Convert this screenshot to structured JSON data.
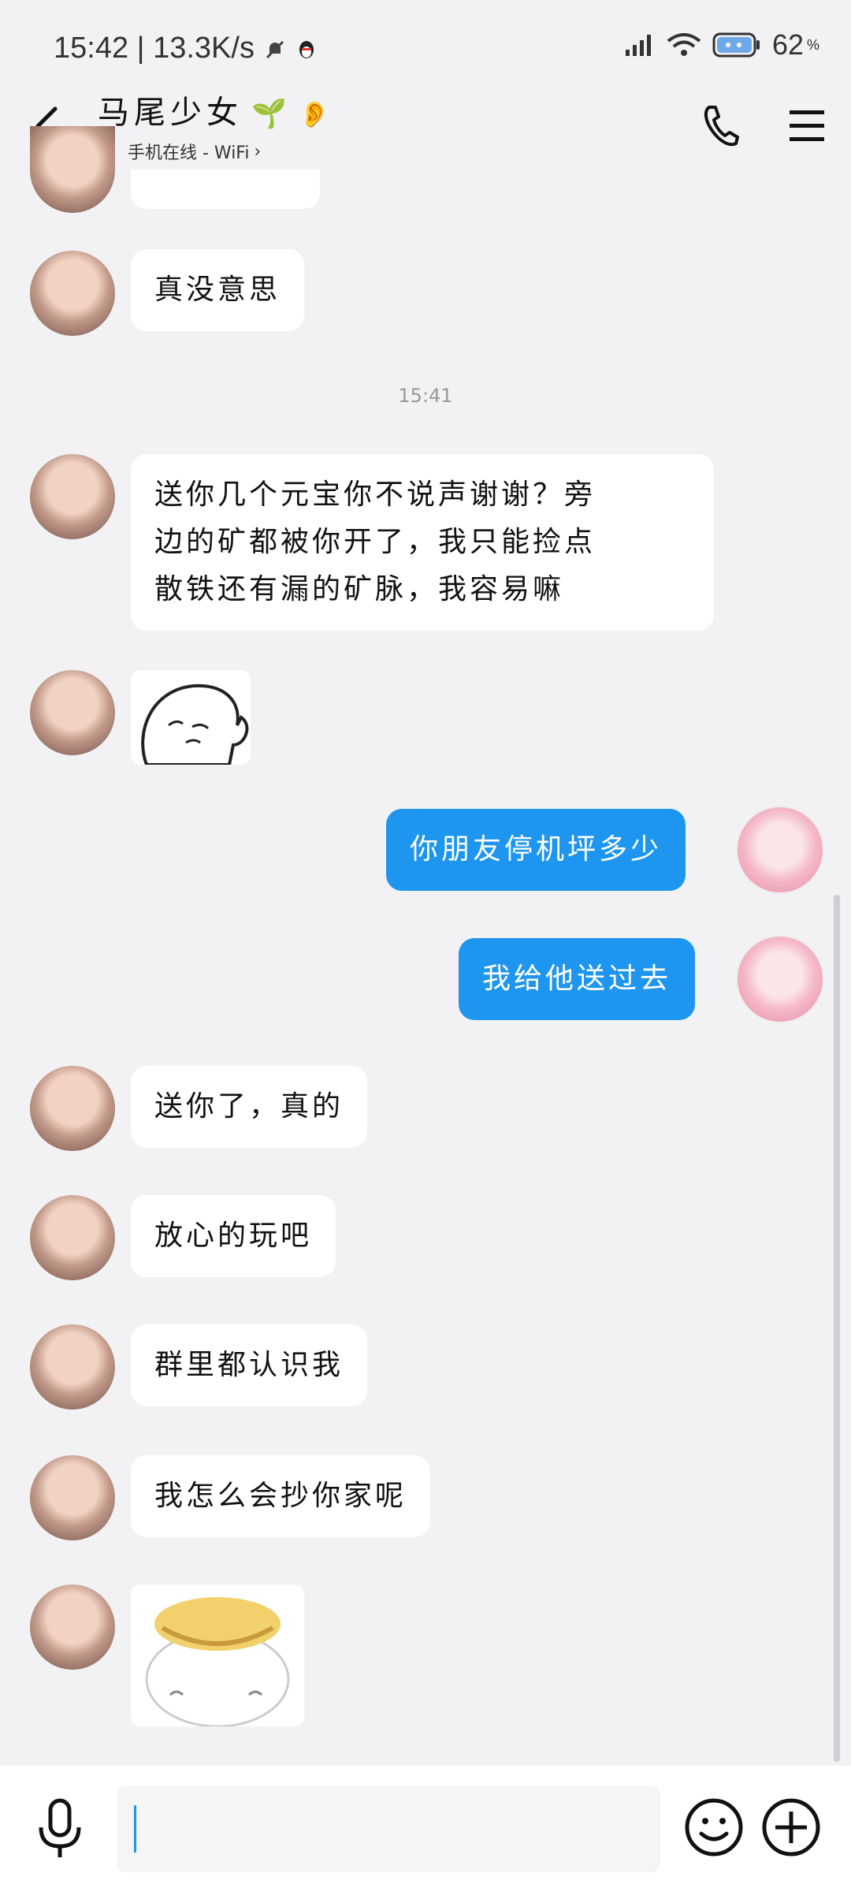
{
  "status_bar": {
    "time": "15:42",
    "net_speed": "13.3K/s",
    "battery": "62"
  },
  "header": {
    "title": "马尾少女",
    "status": "手机在线 - WiFi"
  },
  "timestamp": "15:41",
  "messages": [
    {
      "side": "left",
      "text": "真没意思"
    },
    {
      "side": "left",
      "line1": "送你几个元宝你不说声谢谢？旁",
      "line2": "边的矿都被你开了，我只能捡点",
      "line3": "散铁还有漏的矿脉，我容易嘛"
    },
    {
      "side": "right",
      "text": "你朋友停机坪多少"
    },
    {
      "side": "right",
      "text": "我给他送过去"
    },
    {
      "side": "left",
      "text": "送你了，真的"
    },
    {
      "side": "left",
      "text": "放心的玩吧"
    },
    {
      "side": "left",
      "text": "群里都认识我"
    },
    {
      "side": "left",
      "text": "我怎么会抄你家呢"
    }
  ],
  "colors": {
    "sent_bubble": "#1e96f0",
    "received_bubble": "#ffffff",
    "background": "#f2f2f4",
    "online": "#2ecc71"
  },
  "icons": [
    "back-arrow-icon",
    "phone-icon",
    "menu-icon",
    "mic-icon",
    "emoji-icon",
    "plus-icon",
    "signal-icon",
    "wifi-icon",
    "battery-icon",
    "mute-bell-icon",
    "qq-penguin-icon",
    "sprout-icon",
    "ear-icon"
  ]
}
